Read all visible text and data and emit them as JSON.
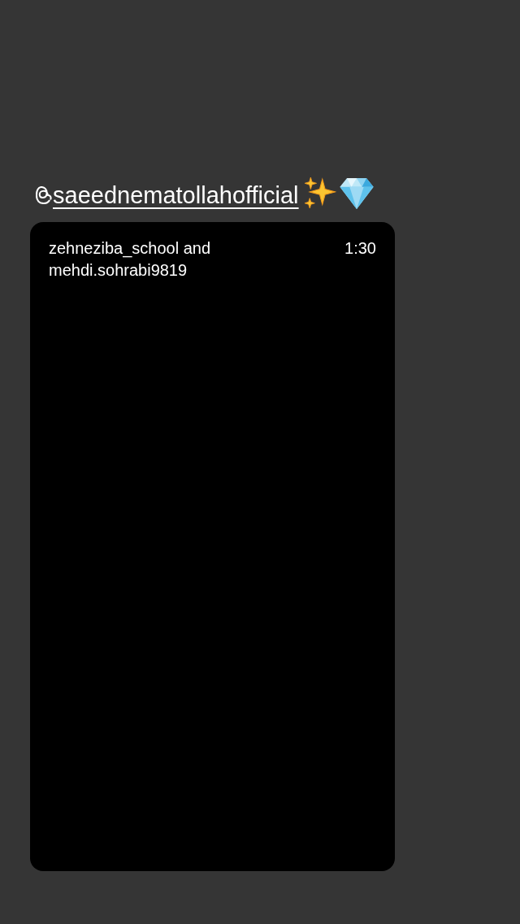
{
  "mention": {
    "username": "saeednematollahofficial"
  },
  "shared_post": {
    "authors": "zehneziba_school and mehdi.sohrabi9819",
    "duration": "1:30"
  }
}
